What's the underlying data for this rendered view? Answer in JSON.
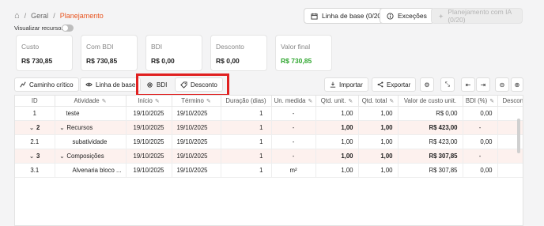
{
  "breadcrumb": {
    "home": "⌂",
    "sep": "/",
    "level1": "Geral",
    "current": "Planejamento"
  },
  "header": {
    "baseline_btn": "Linha de base (0/20)",
    "exceptions_btn": "Exceções",
    "ai_btn": "Planejamento com IA (0/20)"
  },
  "visualizar_recursos": "Visualizar recursos",
  "cards": [
    {
      "label": "Custo",
      "value": "R$ 730,85"
    },
    {
      "label": "Com BDI",
      "value": "R$ 730,85"
    },
    {
      "label": "BDI",
      "value": "R$ 0,00"
    },
    {
      "label": "Desconto",
      "value": "R$ 0,00"
    },
    {
      "label": "Valor final",
      "value": "R$ 730,85"
    }
  ],
  "toolbar": {
    "critical_path": "Caminho crítico",
    "baseline": "Linha de base",
    "bdi": "BDI",
    "discount": "Desconto",
    "import": "Importar",
    "export": "Exportar"
  },
  "table": {
    "headers": [
      "ID",
      "Atividade",
      "Início",
      "Término",
      "Duração (dias)",
      "Un. medida",
      "Qtd. unit.",
      "Qtd. total",
      "Valor de custo unit.",
      "BDI (%)",
      "Desconto"
    ],
    "rows": [
      [
        "1",
        "teste",
        "19/10/2025",
        "19/10/2025",
        "1",
        "-",
        "1,00",
        "1,00",
        "R$ 0,00",
        "0,00",
        "0,0"
      ],
      [
        "2",
        "Recursos",
        "19/10/2025",
        "19/10/2025",
        "1",
        "-",
        "1,00",
        "1,00",
        "R$ 423,00",
        "-",
        "0,0"
      ],
      [
        "2.1",
        "subatividade",
        "19/10/2025",
        "19/10/2025",
        "1",
        "-",
        "1,00",
        "1,00",
        "R$ 423,00",
        "0,00",
        "0,0"
      ],
      [
        "3",
        "Composições",
        "19/10/2025",
        "19/10/2025",
        "1",
        "-",
        "1,00",
        "1,00",
        "R$ 307,85",
        "-",
        "0,0"
      ],
      [
        "3.1",
        "Alvenaria bloco ...",
        "19/10/2025",
        "19/10/2025",
        "1",
        "m²",
        "1,00",
        "1,00",
        "R$ 307,85",
        "0,00",
        "0,0"
      ]
    ]
  },
  "colors": {
    "accent": "#e8541f",
    "green": "#2fa62f",
    "group_bg": "#fdf1ee",
    "highlight": "#e02020"
  }
}
